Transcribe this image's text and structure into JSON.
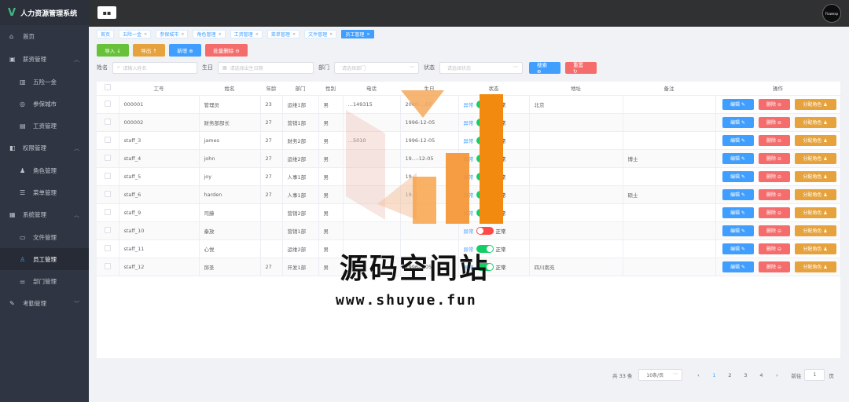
{
  "app": {
    "title": "人力资源管理系统",
    "logo_glyph": "V"
  },
  "sidebar": {
    "items": [
      {
        "label": "首页",
        "icon": "home-icon",
        "level": 1
      },
      {
        "label": "薪资管理",
        "icon": "wallet-icon",
        "level": 1,
        "expanded": true
      },
      {
        "label": "五险一金",
        "icon": "chart-icon",
        "level": 2
      },
      {
        "label": "参保城市",
        "icon": "compass-icon",
        "level": 2
      },
      {
        "label": "工资管理",
        "icon": "tickets-icon",
        "level": 2
      },
      {
        "label": "权限管理",
        "icon": "box-icon",
        "level": 1,
        "expanded": true
      },
      {
        "label": "角色管理",
        "icon": "user-icon",
        "level": 2
      },
      {
        "label": "菜单管理",
        "icon": "menu-icon",
        "level": 2
      },
      {
        "label": "系统管理",
        "icon": "folder-icon",
        "level": 1,
        "expanded": true
      },
      {
        "label": "文件管理",
        "icon": "folder-icon",
        "level": 2
      },
      {
        "label": "员工管理",
        "icon": "user-icon",
        "level": 2,
        "active": true
      },
      {
        "label": "部门管理",
        "icon": "sliders-icon",
        "level": 2
      },
      {
        "label": "考勤管理",
        "icon": "edit-icon",
        "level": 1
      }
    ]
  },
  "header": {
    "avatar_text": "Flowexp"
  },
  "tabs": [
    {
      "label": "首页",
      "closable": false
    },
    {
      "label": "五险一金",
      "closable": true
    },
    {
      "label": "参保城市",
      "closable": true
    },
    {
      "label": "角色管理",
      "closable": true
    },
    {
      "label": "工资管理",
      "closable": true
    },
    {
      "label": "菜单管理",
      "closable": true
    },
    {
      "label": "文件管理",
      "closable": true
    },
    {
      "label": "员工管理",
      "closable": true,
      "active": true
    }
  ],
  "toolbar": {
    "import": "导入 ↓",
    "export": "导出 ↑",
    "add": "新增 ⊕",
    "batch_delete": "批量删除 ⊖"
  },
  "filters": {
    "name_label": "姓名",
    "name_placeholder": "请输入姓名",
    "birth_label": "生日",
    "birth_placeholder": "请选择出生日期",
    "dept_label": "部门",
    "dept_placeholder": "请选择部门",
    "status_label": "状态",
    "status_placeholder": "请选择状态",
    "search": "搜索 ⊕",
    "reset": "重置 ↻"
  },
  "table": {
    "headers": [
      "",
      "工号",
      "姓名",
      "年龄",
      "部门",
      "性别",
      "电话",
      "生日",
      "状态",
      "地址",
      "备注",
      "操作"
    ],
    "status_off": "异常",
    "status_on": "正常",
    "edit": "编辑 ✎",
    "delete": "删除 ⊖",
    "assign": "分配角色 ♟",
    "rows": [
      {
        "id": "000001",
        "name": "管理员",
        "age": "23",
        "dept": "运维1部",
        "gender": "男",
        "phone": "…149315",
        "birth": "2000-…07",
        "on": true,
        "addr": "北京",
        "note": ""
      },
      {
        "id": "000002",
        "name": "财务部部长",
        "age": "27",
        "dept": "营销1部",
        "gender": "男",
        "phone": "",
        "birth": "1996-12-05",
        "on": true,
        "addr": "",
        "note": ""
      },
      {
        "id": "staff_3",
        "name": "james",
        "age": "27",
        "dept": "财务2部",
        "gender": "男",
        "phone": "…5010",
        "birth": "1996-12-05",
        "on": true,
        "addr": "",
        "note": ""
      },
      {
        "id": "staff_4",
        "name": "john",
        "age": "27",
        "dept": "运维2部",
        "gender": "男",
        "phone": "",
        "birth": "19…-12-05",
        "on": true,
        "addr": "",
        "note": "博士"
      },
      {
        "id": "staff_5",
        "name": "joy",
        "age": "27",
        "dept": "人事1部",
        "gender": "男",
        "phone": "",
        "birth": "19…",
        "on": true,
        "addr": "",
        "note": ""
      },
      {
        "id": "staff_6",
        "name": "harden",
        "age": "27",
        "dept": "人事1部",
        "gender": "男",
        "phone": "",
        "birth": "19…",
        "on": true,
        "addr": "",
        "note": "硕士"
      },
      {
        "id": "staff_9",
        "name": "司藤",
        "age": "",
        "dept": "营销2部",
        "gender": "男",
        "phone": "",
        "birth": "",
        "on": true,
        "addr": "",
        "note": ""
      },
      {
        "id": "staff_10",
        "name": "秦放",
        "age": "",
        "dept": "营销1部",
        "gender": "男",
        "phone": "",
        "birth": "",
        "on": false,
        "addr": "",
        "note": ""
      },
      {
        "id": "staff_11",
        "name": "心悦",
        "age": "",
        "dept": "运维2部",
        "gender": "男",
        "phone": "",
        "birth": "",
        "on": true,
        "addr": "",
        "note": ""
      },
      {
        "id": "staff_12",
        "name": "邱圣",
        "age": "27",
        "dept": "开发1部",
        "gender": "男",
        "phone": "",
        "birth": "1996-…05",
        "on": true,
        "addr": "四川南充",
        "note": ""
      }
    ]
  },
  "pagination": {
    "total": "共 33 条",
    "size": "10条/页",
    "pages": [
      "1",
      "2",
      "3",
      "4"
    ],
    "current": "1",
    "goto_label": "前往",
    "goto_value": "1",
    "goto_suffix": "页"
  },
  "watermark": {
    "title": "源码空间站",
    "url": "www.shuyue.fun"
  },
  "colors": {
    "primary": "#409eff",
    "success": "#67c23a",
    "warning": "#e6a23c",
    "danger": "#f56c6c",
    "sidebar": "#2f3542"
  }
}
